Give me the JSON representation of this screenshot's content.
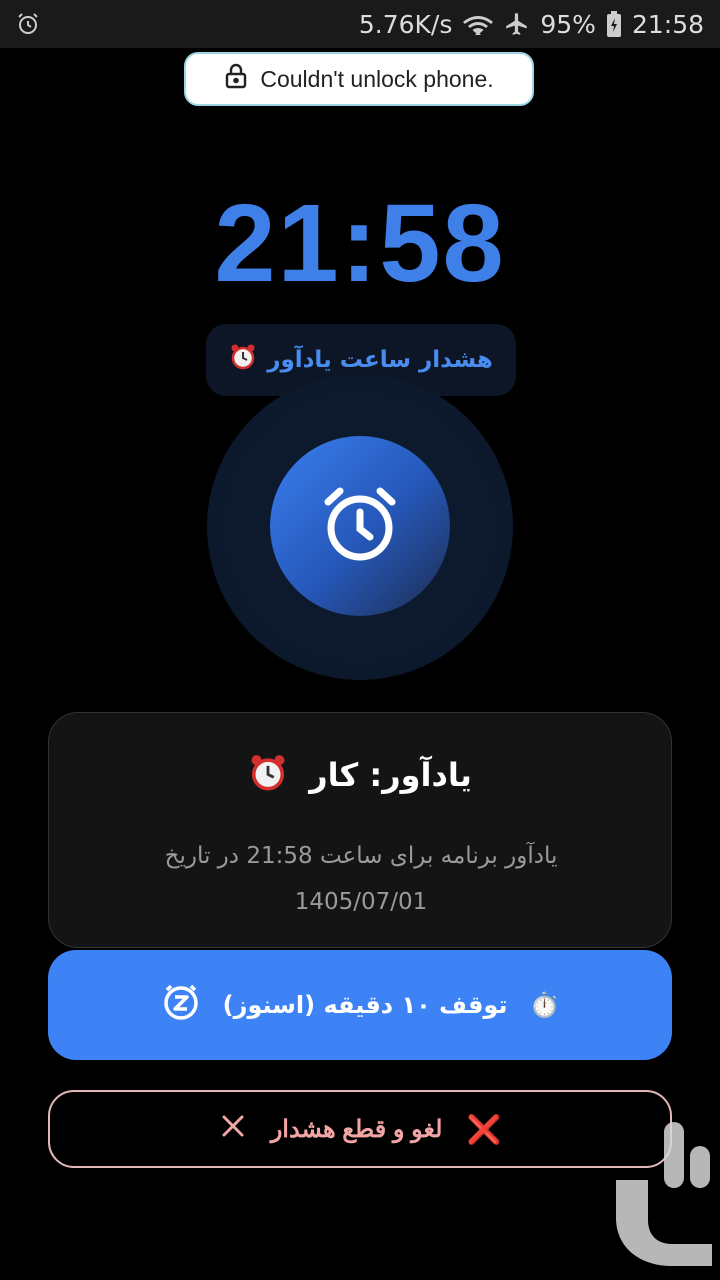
{
  "status_bar": {
    "net_speed": "5.76K/s",
    "battery": "95%",
    "time": "21:58",
    "icons": [
      "alarm-icon",
      "wifi-icon",
      "airplane-icon",
      "battery-charging-icon"
    ]
  },
  "toast": {
    "text": "Couldn't unlock phone.",
    "icon": "lock-icon"
  },
  "clock": {
    "time": "21:58"
  },
  "chip": {
    "label": "هشدار ساعت یادآور",
    "icon": "alarm-clock-emoji"
  },
  "card": {
    "title": "یادآور: کار",
    "title_icon": "alarm-clock-emoji",
    "line1": "یادآور برنامه برای ساعت 21:58 در تاریخ",
    "line2": "1405/07/01"
  },
  "snooze_button": {
    "label": "توقف ۱۰ دقیقه (اسنوز)",
    "icon": "snooze-z-icon",
    "emoji": "⏱️"
  },
  "cancel_button": {
    "label": "لغو و قطع هشدار",
    "emoji": "❌",
    "icon": "close-icon"
  },
  "colors": {
    "accent": "#3d83f5",
    "clock": "#3f7fe8",
    "cancel_text": "#f2a5a5",
    "card_bg": "#141414"
  }
}
